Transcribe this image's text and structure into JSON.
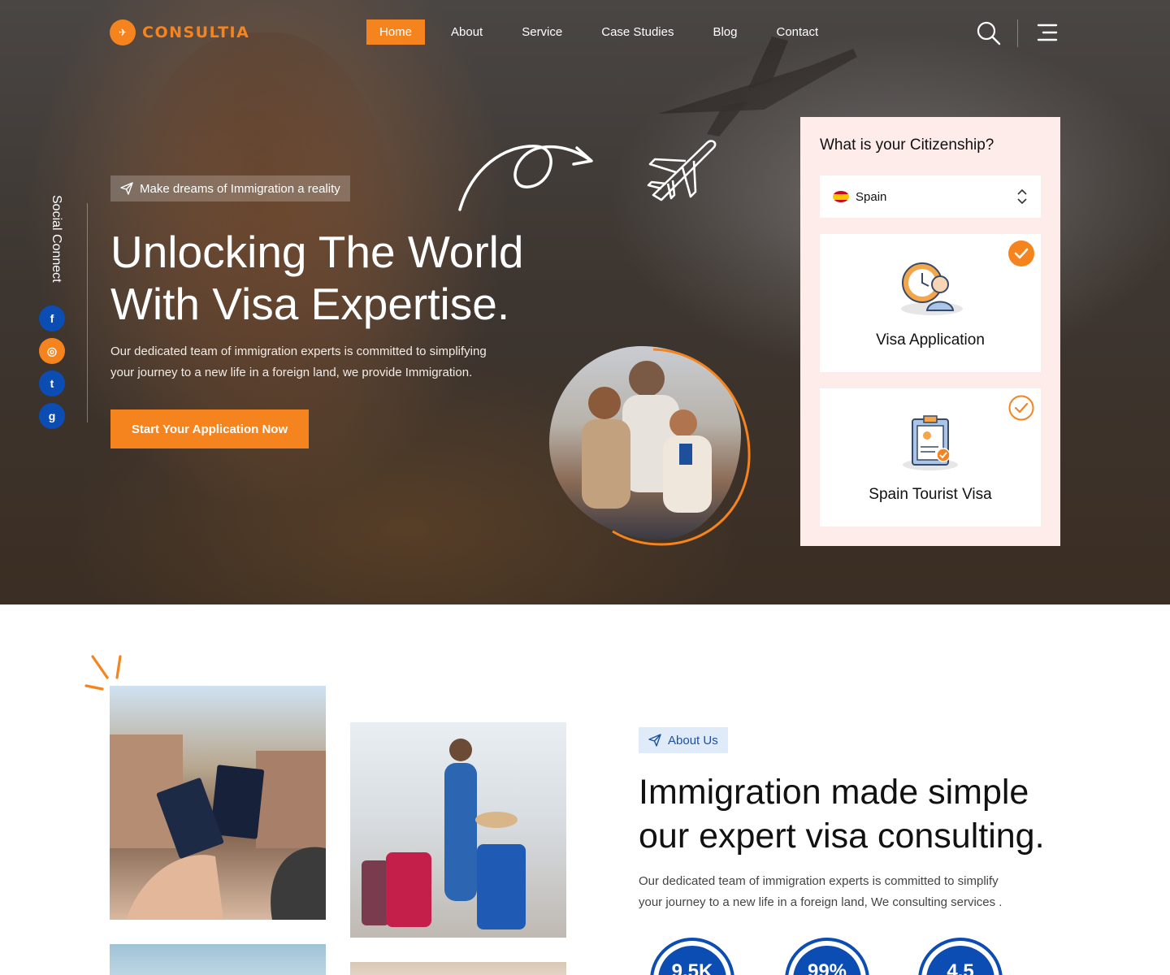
{
  "brand": {
    "name": "CONSULTIA",
    "accent": "#f5841f",
    "blue": "#0b4db3"
  },
  "nav": {
    "items": [
      {
        "label": "Home",
        "active": true
      },
      {
        "label": "About",
        "active": false
      },
      {
        "label": "Service",
        "active": false
      },
      {
        "label": "Case Studies",
        "active": false
      },
      {
        "label": "Blog",
        "active": false
      },
      {
        "label": "Contact",
        "active": false
      }
    ],
    "search_icon": "search-icon",
    "menu_icon": "hamburger-menu-icon"
  },
  "social": {
    "label": "Social Connect",
    "links": [
      {
        "icon": "facebook-icon",
        "glyph": "f",
        "color": "#0b4db3"
      },
      {
        "icon": "instagram-icon",
        "glyph": "◎",
        "color": "#f5841f"
      },
      {
        "icon": "twitter-icon",
        "glyph": "t",
        "color": "#0b4db3"
      },
      {
        "icon": "github-icon",
        "glyph": "g",
        "color": "#0b4db3"
      }
    ]
  },
  "hero": {
    "tagline": "Make dreams of Immigration a reality",
    "title_line1": "Unlocking The World",
    "title_line2": "With Visa Expertise.",
    "description_line1": "Our dedicated team of immigration experts is committed to simplifying",
    "description_line2": "your journey to a new life in a foreign land, we provide Immigration.",
    "cta_label": "Start Your Application Now"
  },
  "citizenship": {
    "question": "What is your Citizenship?",
    "selected_country": "Spain",
    "options": [
      {
        "label": "Visa Application",
        "checked": true
      },
      {
        "label": "Spain Tourist Visa",
        "checked": false
      }
    ]
  },
  "about": {
    "tag": "About Us",
    "title_line1": "Immigration made simple",
    "title_line2": "our expert visa consulting.",
    "description_line1": "Our dedicated team of immigration experts is committed to simplify",
    "description_line2": "your journey to a new life in a foreign land, We consulting services .",
    "stats": [
      {
        "value": "9.5K"
      },
      {
        "value": "99%"
      },
      {
        "value": "4.5"
      }
    ]
  }
}
